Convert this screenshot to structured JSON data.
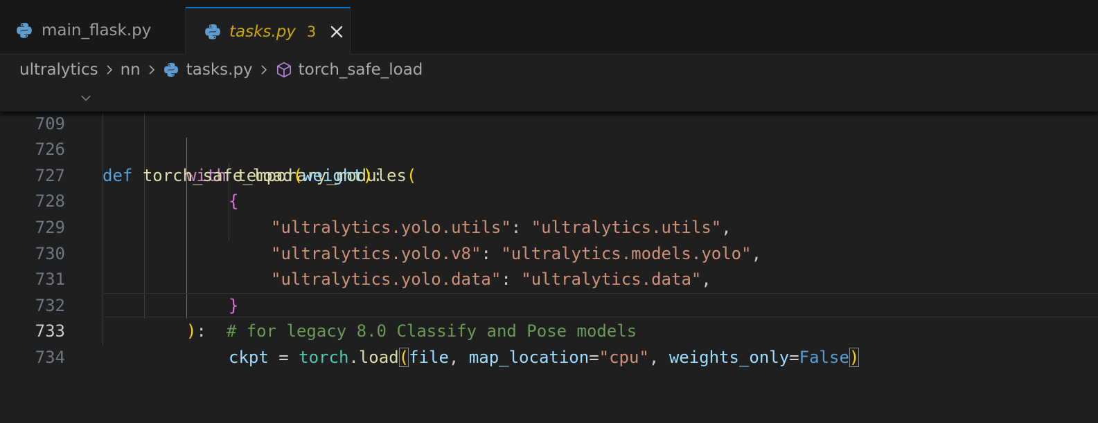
{
  "tabs": [
    {
      "label": "main_flask.py",
      "icon": "python-icon",
      "active": false
    },
    {
      "label": "tasks.py",
      "icon": "python-icon",
      "active": true,
      "problems": "3",
      "modified_color": "#cca700"
    }
  ],
  "breadcrumb": {
    "items": [
      "ultralytics",
      "nn",
      "tasks.py",
      "torch_safe_load"
    ],
    "icons": [
      "",
      "",
      "python-icon",
      "symbol-method-icon"
    ]
  },
  "editor": {
    "sticky": {
      "number": "709",
      "tokens": [
        "def",
        " ",
        "torch_safe_load",
        "(",
        "weight",
        ")",
        ":"
      ]
    },
    "lines": [
      {
        "number": "726",
        "tokens": [
          "with",
          " ",
          "temporary_modules",
          "("
        ]
      },
      {
        "number": "727",
        "tokens": [
          "{"
        ]
      },
      {
        "number": "728",
        "tokens": [
          "\"ultralytics.yolo.utils\"",
          ": ",
          "\"ultralytics.utils\"",
          ","
        ]
      },
      {
        "number": "729",
        "tokens": [
          "\"ultralytics.yolo.v8\"",
          ": ",
          "\"ultralytics.models.yolo\"",
          ","
        ]
      },
      {
        "number": "730",
        "tokens": [
          "\"ultralytics.yolo.data\"",
          ": ",
          "\"ultralytics.data\"",
          ","
        ]
      },
      {
        "number": "731",
        "tokens": [
          "}"
        ]
      },
      {
        "number": "732",
        "tokens": [
          ")",
          ":  ",
          "# for legacy 8.0 Classify and Pose models"
        ]
      },
      {
        "number": "733",
        "tokens": [
          "ckpt",
          " = ",
          "torch",
          ".",
          "load",
          "(",
          "file",
          ", ",
          "map_location",
          "=",
          "\"cpu\"",
          ", ",
          "weights_only",
          "=",
          "False",
          ")"
        ]
      },
      {
        "number": "734",
        "tokens": [
          ""
        ]
      }
    ],
    "active_line": "733"
  },
  "colors": {
    "background": "#1f1f1f",
    "tab_active_border": "#0078d4",
    "keyword": "#569cd6",
    "control_keyword": "#c586c0",
    "function": "#dcdcaa",
    "parameter": "#9cdcfe",
    "string": "#ce9178",
    "comment": "#6a9955",
    "class": "#4ec9b0",
    "bracket_1": "#ffd700",
    "bracket_2": "#da70d6"
  }
}
